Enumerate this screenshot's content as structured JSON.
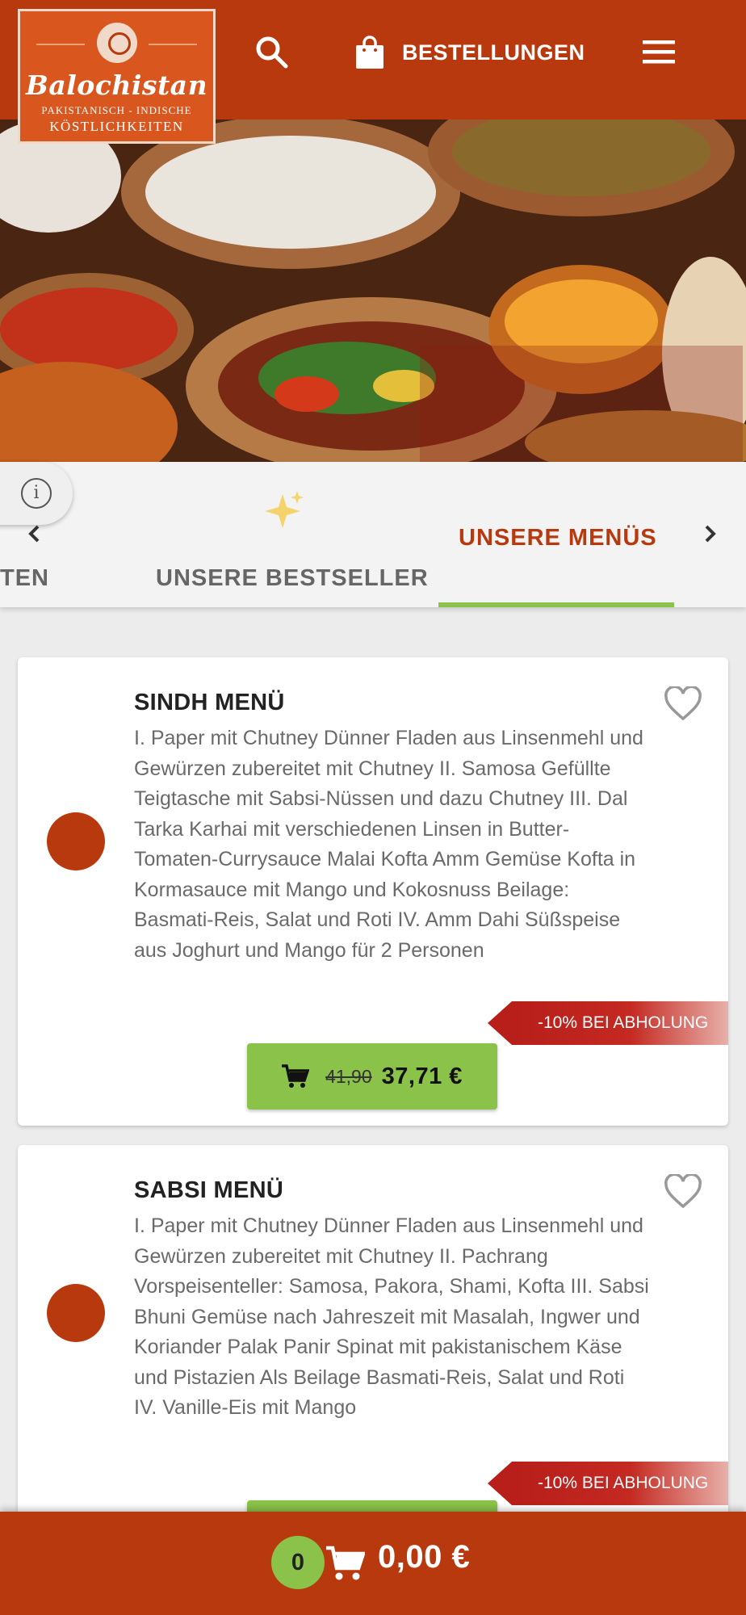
{
  "header": {
    "logo": {
      "brand": "Balochistan",
      "tagline_1": "PAKISTANISCH - INDISCHE",
      "tagline_2": "KÖSTLICHKEITEN"
    },
    "orders_label": "BESTELLUNGEN",
    "icons": [
      "search-icon",
      "shopping-bag-icon",
      "hamburger-menu-icon"
    ]
  },
  "tabs": {
    "items": [
      {
        "label": "TEN",
        "active": false
      },
      {
        "label": "UNSERE BESTSELLER",
        "active": false,
        "icon": "sparkle-icon"
      },
      {
        "label": "UNSERE MENÜS",
        "active": true
      }
    ]
  },
  "cards": [
    {
      "title": "SINDH MENÜ",
      "description": "I. Paper mit Chutney Dünner Fladen aus Linsenmehl und Gewürzen zubereitet mit Chutney II. Samosa Gefüllte Teigtasche mit Sabsi-Nüssen und dazu Chutney III. Dal Tarka Karhai mit verschiedenen Linsen in Butter-Tomaten-Currysauce Malai Kofta Amm Gemüse Kofta in Kormasauce mit Mango und Kokosnuss Beilage: Basmati-Reis, Salat und Roti IV. Amm Dahi Süßspeise aus Joghurt und Mango für 2 Personen",
      "discount": "-10% BEI ABHOLUNG",
      "old_price": "41,90",
      "price": "37,71 €"
    },
    {
      "title": "SABSI MENÜ",
      "description": "I. Paper mit Chutney Dünner Fladen aus Linsenmehl und Gewürzen zubereitet mit Chutney II. Pachrang Vorspeisenteller: Samosa, Pakora, Shami, Kofta III. Sabsi Bhuni Gemüse nach Jahreszeit mit Masalah, Ingwer und Koriander Palak Panir Spinat mit pakistanischem Käse und Pistazien Als Beilage Basmati-Reis, Salat und Roti IV. Vanille-Eis mit Mango",
      "discount": "-10% BEI ABHOLUNG"
    }
  ],
  "cart": {
    "count": "0",
    "total": "0,00 €"
  },
  "colors": {
    "brand": "#b8390e",
    "accent_green": "#8bc34a",
    "discount_red": "#b81e1a"
  }
}
